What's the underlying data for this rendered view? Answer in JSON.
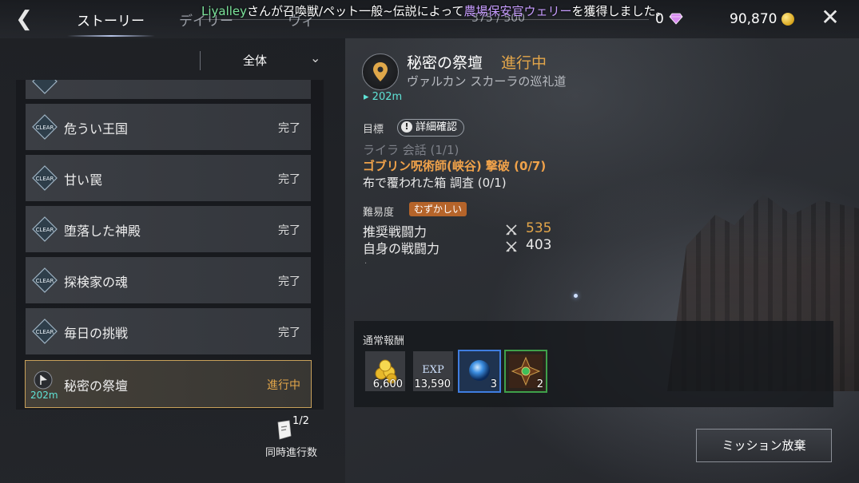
{
  "header": {
    "tabs": [
      {
        "label": "ストーリー",
        "active": true
      },
      {
        "label": "デイリー",
        "active": false
      },
      {
        "label": "ウィ",
        "active": false
      }
    ],
    "tab_counter": "375 / 500",
    "ticker": {
      "name": "Liyalley",
      "text_1": "さんが召喚獣/ペット一般~伝説によって",
      "item": "農場保安官ウェリー",
      "text_2": "を獲得しました。"
    },
    "gems": "0",
    "gold": "90,870",
    "icons": {
      "back": "back-arrow-icon",
      "close": "close-icon",
      "gem": "diamond-icon",
      "gold": "gold-coin-icon"
    }
  },
  "filter": {
    "label": "全体"
  },
  "quest_list": {
    "items": [
      {
        "badge": "CLEAR",
        "name": "危うい王国",
        "status": "完了"
      },
      {
        "badge": "CLEAR",
        "name": "甘い罠",
        "status": "完了"
      },
      {
        "badge": "CLEAR",
        "name": "堕落した神殿",
        "status": "完了"
      },
      {
        "badge": "CLEAR",
        "name": "探検家の魂",
        "status": "完了"
      },
      {
        "badge": "CLEAR",
        "name": "毎日の挑戦",
        "status": "完了"
      }
    ],
    "active": {
      "name": "秘密の祭壇",
      "status": "進行中",
      "distance": "202m"
    }
  },
  "concurrent": {
    "count": "1/2",
    "label": "同時進行数"
  },
  "detail": {
    "title": "秘密の祭壇",
    "state": "進行中",
    "location": "ヴァルカン スカーラの巡礼道",
    "distance": "202m",
    "objective_label": "目標",
    "detail_button": "詳細確認",
    "objectives": [
      {
        "text": "ライラ 会話 (1/1)",
        "style": "done"
      },
      {
        "text": "ゴブリン呪術師(峡谷) 撃破 (0/7)",
        "style": "highlight"
      },
      {
        "text": "布で覆われた箱 調査 (0/1)",
        "style": "normal"
      }
    ],
    "difficulty_label": "難易度",
    "difficulty": "むずかしい",
    "recommended_label": "推奨戦闘力",
    "recommended_value": "535",
    "own_label": "自身の戦闘力",
    "own_value": "403",
    "dot": "."
  },
  "rewards": {
    "title": "通常報酬",
    "items": [
      {
        "icon": "gold-coins-icon",
        "count": "6,600"
      },
      {
        "icon": "exp-icon",
        "label": "EXP",
        "count": "13,590"
      },
      {
        "icon": "blue-orb-icon",
        "count": "3"
      },
      {
        "icon": "emblem-item-icon",
        "count": "2"
      }
    ]
  },
  "abandon_button": "ミッション放棄",
  "colors": {
    "accent_orange": "#e3a64a",
    "distance_cyan": "#5fe3d6",
    "active_border": "#c8a15a"
  }
}
